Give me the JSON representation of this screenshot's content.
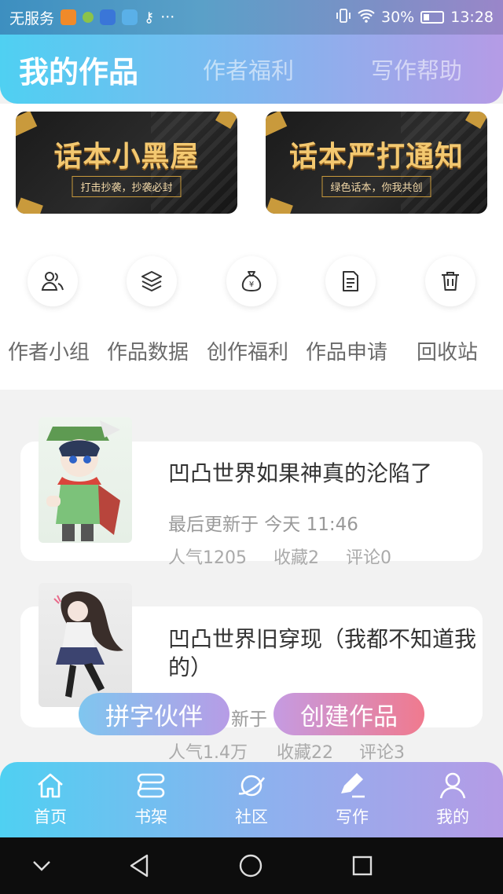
{
  "status_bar": {
    "carrier": "无服务",
    "battery": "30%",
    "time": "13:28",
    "dots": "···"
  },
  "header": {
    "tabs": [
      {
        "label": "我的作品",
        "active": true
      },
      {
        "label": "作者福利",
        "active": false
      },
      {
        "label": "写作帮助",
        "active": false
      }
    ]
  },
  "banners": [
    {
      "title": "话本小黑屋",
      "subtitle": "打击抄袭，抄袭必封"
    },
    {
      "title": "话本严打通知",
      "subtitle": "绿色话本，你我共创"
    }
  ],
  "shortcuts": [
    {
      "label": "作者小组",
      "icon": "people-icon"
    },
    {
      "label": "作品数据",
      "icon": "layers-icon"
    },
    {
      "label": "创作福利",
      "icon": "money-bag-icon"
    },
    {
      "label": "作品申请",
      "icon": "document-icon"
    },
    {
      "label": "回收站",
      "icon": "trash-icon"
    }
  ],
  "works": [
    {
      "title": "凹凸世界如果神真的沦陷了",
      "updated": "最后更新于 今天 11:46",
      "popularity": "人气1205",
      "favorites": "收藏2",
      "comments": "评论0"
    },
    {
      "title_line1": "凹凸世界旧穿现（我都不知道我",
      "title_line2": "的）",
      "updated_partial": "新于",
      "popularity": "人气1.4万",
      "favorites": "收藏22",
      "comments": "评论3"
    }
  ],
  "floating_buttons": {
    "partner": "拼字伙伴",
    "create": "创建作品"
  },
  "bottom_nav": [
    {
      "label": "首页",
      "icon": "home-icon"
    },
    {
      "label": "书架",
      "icon": "bookshelf-icon"
    },
    {
      "label": "社区",
      "icon": "planet-icon"
    },
    {
      "label": "写作",
      "icon": "pen-icon",
      "active": true
    },
    {
      "label": "我的",
      "icon": "user-icon"
    }
  ],
  "colors": {
    "header_gradient_start": "#4fd0f2",
    "header_gradient_end": "#b59be6",
    "banner_gold": "#f3c870",
    "create_button_end": "#f07a8e"
  }
}
